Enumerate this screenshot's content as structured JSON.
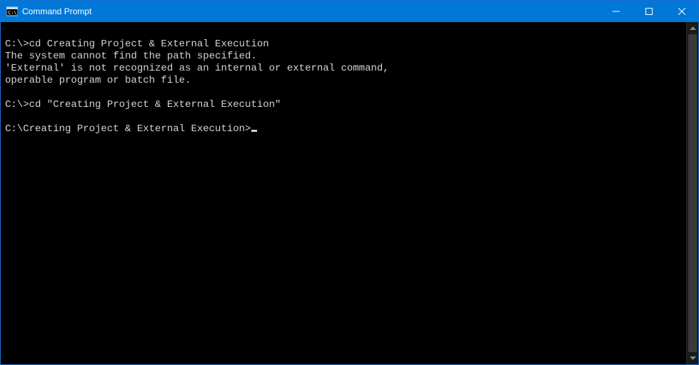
{
  "window": {
    "title": "Command Prompt"
  },
  "terminal": {
    "lines": [
      "",
      "C:\\>cd Creating Project & External Execution",
      "The system cannot find the path specified.",
      "'External' is not recognized as an internal or external command,",
      "operable program or batch file.",
      "",
      "C:\\>cd \"Creating Project & External Execution\"",
      "",
      "C:\\Creating Project & External Execution>"
    ]
  }
}
